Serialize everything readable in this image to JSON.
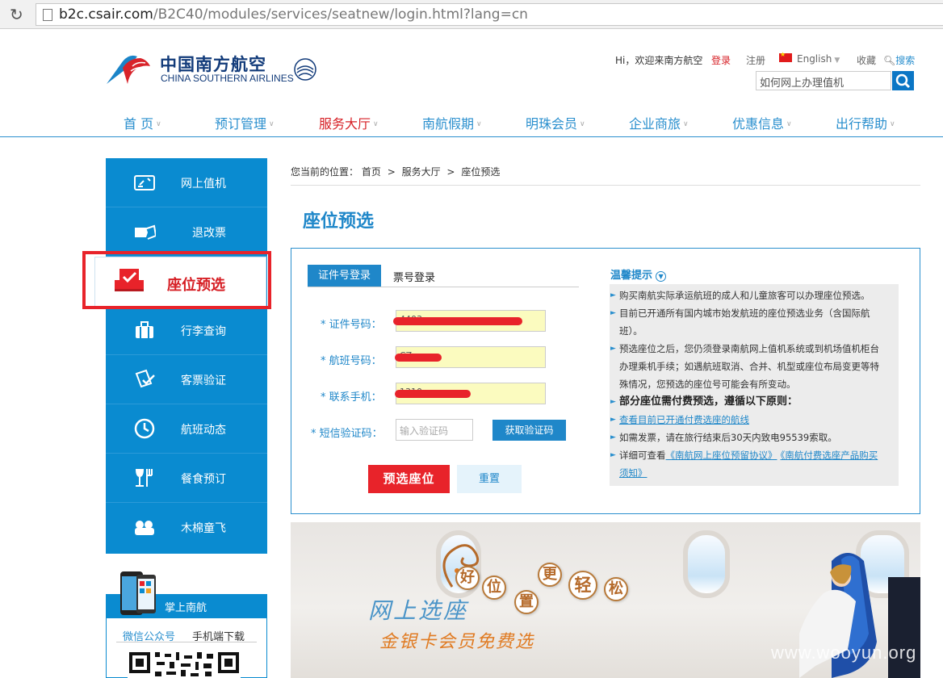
{
  "browser": {
    "url_host": "b2c.csair.com",
    "url_path": "/B2C40/modules/services/seatnew/login.html?lang=cn"
  },
  "header": {
    "logo_cn": "中国南方航空",
    "logo_en": "CHINA SOUTHERN AIRLINES",
    "greeting": "Hi，欢迎来南方航空",
    "login": "登录",
    "register": "注册",
    "language": "English",
    "favorite": "收藏",
    "search_label": "搜索",
    "search_value": "如何网上办理值机"
  },
  "nav": [
    {
      "label": "首 页",
      "active": false
    },
    {
      "label": "预订管理",
      "active": false
    },
    {
      "label": "服务大厅",
      "active": true
    },
    {
      "label": "南航假期",
      "active": false
    },
    {
      "label": "明珠会员",
      "active": false
    },
    {
      "label": "企业商旅",
      "active": false
    },
    {
      "label": "优惠信息",
      "active": false
    },
    {
      "label": "出行帮助",
      "active": false
    }
  ],
  "sidebar": {
    "items": [
      {
        "label": "网上值机",
        "icon": "checkin-icon"
      },
      {
        "label": "退改票",
        "icon": "ticket-change-icon"
      },
      {
        "label": "座位预选",
        "icon": "seat-select-icon"
      },
      {
        "label": "行李查询",
        "icon": "luggage-icon"
      },
      {
        "label": "客票验证",
        "icon": "ticket-verify-icon"
      },
      {
        "label": "航班动态",
        "icon": "clock-icon"
      },
      {
        "label": "餐食预订",
        "icon": "meal-icon"
      },
      {
        "label": "木棉童飞",
        "icon": "kids-icon"
      }
    ],
    "app": {
      "title": "掌上南航",
      "tab_wechat": "微信公众号",
      "tab_mobile": "手机端下载"
    }
  },
  "breadcrumb": {
    "prefix": "您当前的位置：",
    "home": "首页",
    "sep": ">",
    "level1": "服务大厅",
    "level2": "座位预选"
  },
  "page": {
    "title": "座位预选"
  },
  "form": {
    "tab_id": "证件号登录",
    "tab_ticket": "票号登录",
    "id_label": "* 证件号码：",
    "id_value": "4403",
    "flight_label": "* 航班号码：",
    "flight_value": "CZ",
    "phone_label": "* 联系手机：",
    "phone_value": "1310",
    "sms_label": "* 短信验证码：",
    "sms_placeholder": "输入验证码",
    "sms_button": "获取验证码",
    "submit": "预选座位",
    "reset": "重置"
  },
  "tips": {
    "title": "温馨提示",
    "lines": [
      "购买南航实际承运航班的成人和儿童旅客可以办理座位预选。",
      "目前已开通所有国内城市始发航班的座位预选业务（含国际航",
      "班）。",
      "预选座位之后，您仍须登录南航网上值机系统或到机场值机柜台",
      "办理乘机手续；如遇航班取消、合并、机型或座位布局变更等特",
      "殊情况，您预选的座位号可能会有所变动。",
      "部分座位需付费预选，遵循以下原则：",
      "查看目前已开通付费选座的航线",
      "如需发票，请在旅行结束后30天内致电95539索取。",
      "详细可查看",
      "《南航网上座位预留协议》",
      "《南航付费选座产品购买",
      "须知》"
    ]
  },
  "banner": {
    "chars": [
      "好",
      "位",
      "置",
      "更",
      "轻",
      "松"
    ],
    "headline": "网上选座",
    "subline": "金银卡会员免费选"
  },
  "watermark": "www.wooyun.org",
  "colors": {
    "brand_blue": "#0a8bd0",
    "link_blue": "#1f87c9",
    "accent_red": "#e8232a"
  }
}
